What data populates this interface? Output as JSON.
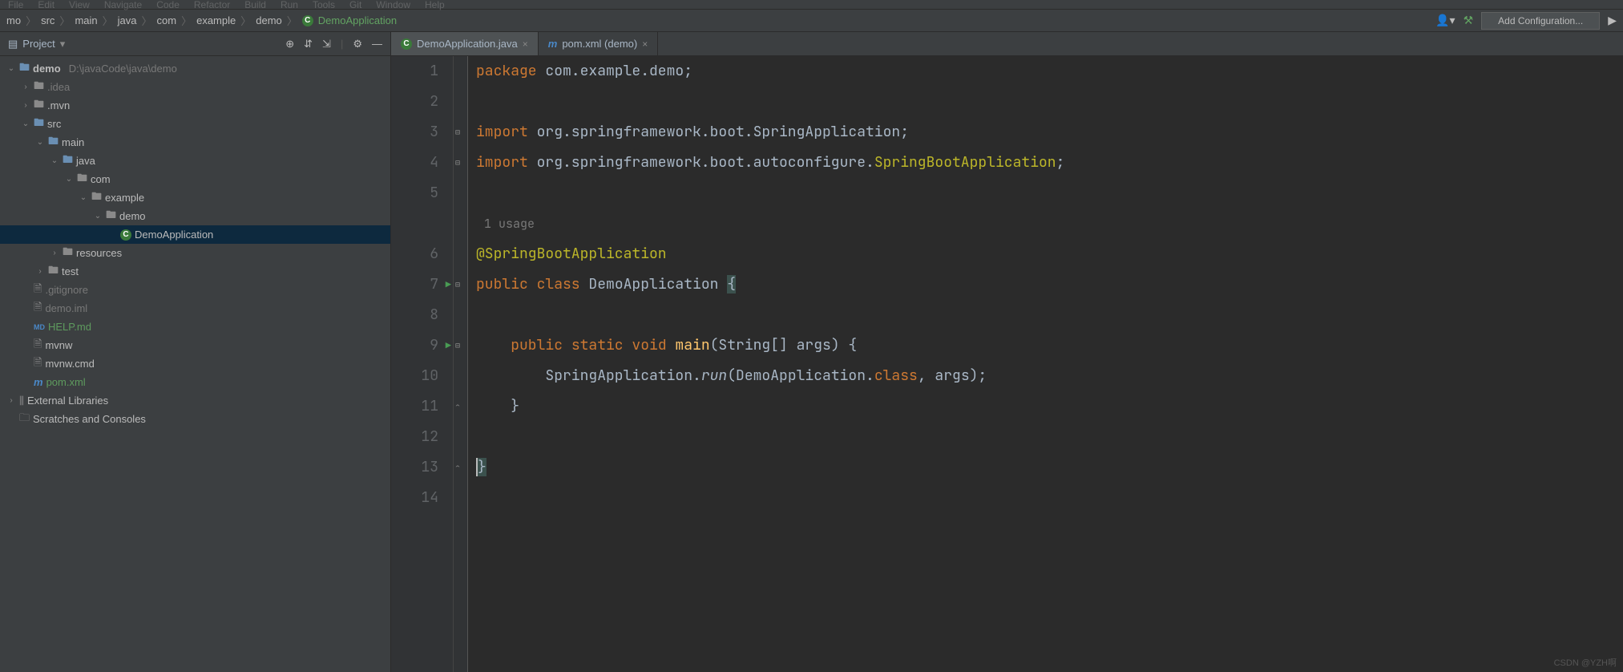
{
  "menubar": [
    "File",
    "Edit",
    "View",
    "Navigate",
    "Code",
    "Refactor",
    "Build",
    "Run",
    "Tools",
    "Git",
    "Window",
    "Help"
  ],
  "breadcrumb": {
    "items": [
      "mo",
      "src",
      "main",
      "java",
      "com",
      "example",
      "demo"
    ],
    "current": "DemoApplication"
  },
  "navbar": {
    "addConfig": "Add Configuration..."
  },
  "sidebar": {
    "title": "Project",
    "tree": [
      {
        "depth": 0,
        "chev": "v",
        "icon": "folder-blue",
        "label": "demo",
        "path": "D:\\javaCode\\java\\demo",
        "bold": true
      },
      {
        "depth": 1,
        "chev": ">",
        "icon": "folder",
        "label": ".idea",
        "dim": true
      },
      {
        "depth": 1,
        "chev": ">",
        "icon": "folder",
        "label": ".mvn"
      },
      {
        "depth": 1,
        "chev": "v",
        "icon": "folder-blue",
        "label": "src"
      },
      {
        "depth": 2,
        "chev": "v",
        "icon": "folder-blue",
        "label": "main"
      },
      {
        "depth": 3,
        "chev": "v",
        "icon": "folder-blue",
        "label": "java"
      },
      {
        "depth": 4,
        "chev": "v",
        "icon": "folder",
        "label": "com"
      },
      {
        "depth": 5,
        "chev": "v",
        "icon": "folder",
        "label": "example"
      },
      {
        "depth": 6,
        "chev": "v",
        "icon": "folder",
        "label": "demo"
      },
      {
        "depth": 7,
        "chev": "",
        "icon": "class",
        "label": "DemoApplication",
        "selected": true
      },
      {
        "depth": 3,
        "chev": ">",
        "icon": "folder-res",
        "label": "resources"
      },
      {
        "depth": 2,
        "chev": ">",
        "icon": "folder",
        "label": "test"
      },
      {
        "depth": 1,
        "chev": "",
        "icon": "file",
        "label": ".gitignore",
        "dim": true
      },
      {
        "depth": 1,
        "chev": "",
        "icon": "file",
        "label": "demo.iml",
        "dim": true
      },
      {
        "depth": 1,
        "chev": "",
        "icon": "md",
        "label": "HELP.md",
        "md": true
      },
      {
        "depth": 1,
        "chev": "",
        "icon": "file",
        "label": "mvnw"
      },
      {
        "depth": 1,
        "chev": "",
        "icon": "file",
        "label": "mvnw.cmd"
      },
      {
        "depth": 1,
        "chev": "",
        "icon": "maven",
        "label": "pom.xml",
        "xml": true
      },
      {
        "depth": 0,
        "chev": ">",
        "icon": "lib",
        "label": "External Libraries"
      },
      {
        "depth": 0,
        "chev": "",
        "icon": "scratch",
        "label": "Scratches and Consoles"
      }
    ]
  },
  "tabs": [
    {
      "icon": "class",
      "label": "DemoApplication.java",
      "active": true
    },
    {
      "icon": "maven",
      "label": "pom.xml (demo)",
      "active": false
    }
  ],
  "editor": {
    "usageHint": "1 usage",
    "lines": [
      {
        "n": 1,
        "tokens": [
          {
            "t": "package ",
            "c": "kw"
          },
          {
            "t": "com.example.demo",
            "c": "ident"
          },
          {
            "t": ";",
            "c": "ident"
          }
        ]
      },
      {
        "n": 2,
        "tokens": []
      },
      {
        "n": 3,
        "fold": "-",
        "tokens": [
          {
            "t": "import ",
            "c": "kw"
          },
          {
            "t": "org.springframework.boot.SpringApplication;",
            "c": "ident"
          }
        ]
      },
      {
        "n": 4,
        "fold": "-",
        "tokens": [
          {
            "t": "import ",
            "c": "kw"
          },
          {
            "t": "org.springframework.boot.autoconfigure.",
            "c": "ident"
          },
          {
            "t": "SpringBootApplication",
            "c": "ann"
          },
          {
            "t": ";",
            "c": "ident"
          }
        ]
      },
      {
        "n": 5,
        "tokens": []
      },
      {
        "n": null,
        "hint": true
      },
      {
        "n": 6,
        "tokens": [
          {
            "t": "@SpringBootApplication",
            "c": "ann"
          }
        ]
      },
      {
        "n": 7,
        "run": true,
        "fold": "-",
        "tokens": [
          {
            "t": "public ",
            "c": "kw"
          },
          {
            "t": "class ",
            "c": "kw"
          },
          {
            "t": "DemoApplication ",
            "c": "cls"
          },
          {
            "t": "{",
            "c": "ident",
            "hl": true
          }
        ]
      },
      {
        "n": 8,
        "tokens": []
      },
      {
        "n": 9,
        "run": true,
        "fold": "-",
        "tokens": [
          {
            "t": "    ",
            "c": ""
          },
          {
            "t": "public ",
            "c": "kw"
          },
          {
            "t": "static ",
            "c": "kw"
          },
          {
            "t": "void ",
            "c": "kw"
          },
          {
            "t": "main",
            "c": "method"
          },
          {
            "t": "(String[] args) {",
            "c": "ident"
          }
        ]
      },
      {
        "n": 10,
        "tokens": [
          {
            "t": "        SpringApplication.",
            "c": "ident"
          },
          {
            "t": "run",
            "c": "static-m"
          },
          {
            "t": "(DemoApplication.",
            "c": "ident"
          },
          {
            "t": "class",
            "c": "kw"
          },
          {
            "t": ", args);",
            "c": "ident"
          }
        ]
      },
      {
        "n": 11,
        "fold": "^",
        "tokens": [
          {
            "t": "    }",
            "c": "ident"
          }
        ]
      },
      {
        "n": 12,
        "tokens": []
      },
      {
        "n": 13,
        "fold": "^",
        "tokens": [
          {
            "t": "}",
            "c": "ident",
            "hl": true,
            "caret": true
          }
        ]
      },
      {
        "n": 14,
        "tokens": []
      }
    ]
  },
  "watermark": "CSDN @YZH啊"
}
